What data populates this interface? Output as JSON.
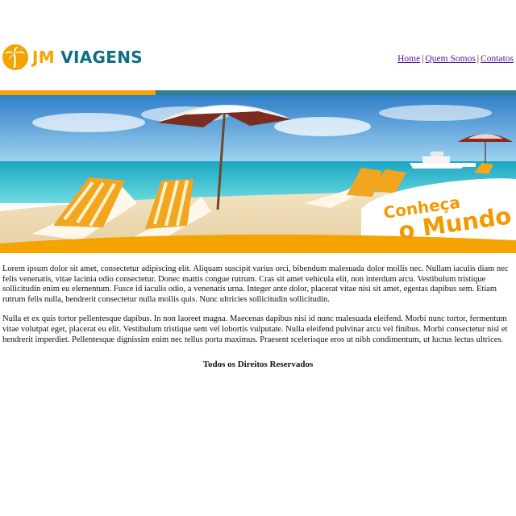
{
  "brand": {
    "part1": "JM",
    "part2": "VIAGENS"
  },
  "nav": {
    "items": [
      {
        "label": "Home"
      },
      {
        "label": "Quem Somos"
      },
      {
        "label": "Contatos"
      }
    ],
    "separator": "|"
  },
  "banner": {
    "line1": "Conheça",
    "line2": "o Mundo"
  },
  "content": {
    "paragraphs": [
      "Lorem ipsum dolor sit amet, consectetur adipiscing elit. Aliquam suscipit varius orci, bibendum malesuada dolor mollis nec. Nullam iaculis diam nec felis venenatis, vitae lacinia odio consectetur. Donec mattis congue rutrum. Cras sit amet vehicula elit, non interdum arcu. Vestibulum tristique sollicitudin enim eu elementum. Fusce id iaculis odio, a venenatis urna. Integer ante dolor, placerat vitae nisi sit amet, egestas dapibus sem. Etiam rutrum felis nulla, hendrerit consectetur nulla mollis quis. Nunc ultricies sollicitudin sollicitudin.",
      "Nulla et ex quis tortor pellentesque dapibus. In non laoreet magna. Maecenas dapibus nisi id nunc malesuada eleifend. Morbi nunc tortor, fermentum vitae volutpat eget, placerat eu elit. Vestibulum tristique sem vel lobortis vulputate. Nulla eleifend pulvinar arcu vel finibus. Morbi consectetur nisl et hendrerit imperdiet. Pellentesque dignissim enim nec tellus porta maximus. Praesent scelerisque eros ut nibh condimentum, ut luctus lectus ultrices."
    ]
  },
  "footer": {
    "text": "Todos os Direitos Reservados"
  },
  "colors": {
    "brand_orange": "#f5a300",
    "brand_teal": "#0d6f80",
    "link": "#551a8b"
  }
}
